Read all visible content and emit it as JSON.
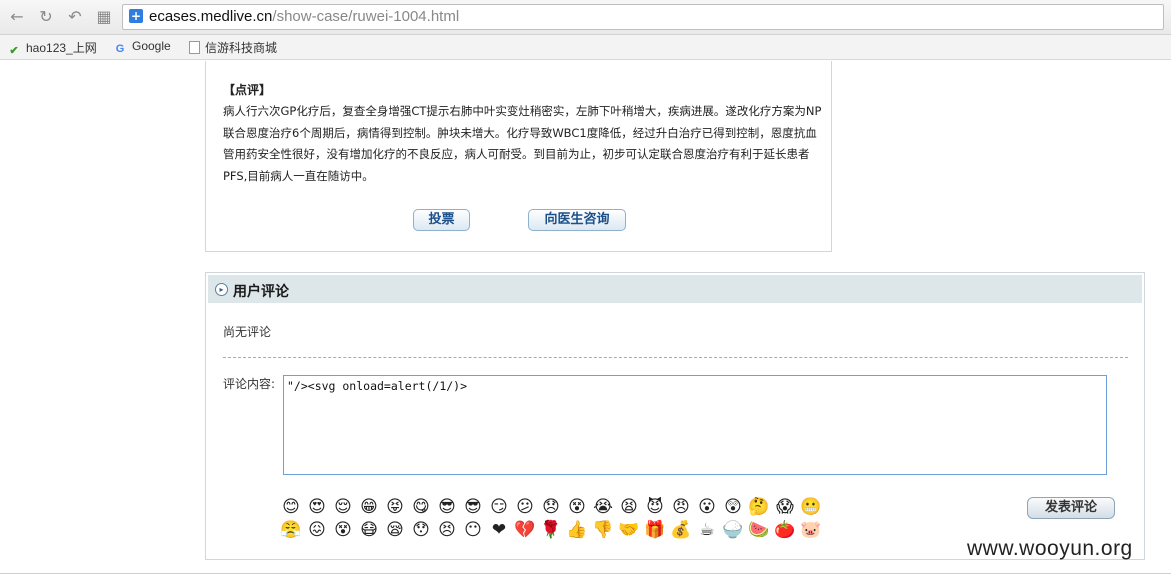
{
  "browser": {
    "url_host": "ecases.medlive.cn",
    "url_path": "/show-case/ruwei-1004.html",
    "bookmarks": [
      {
        "label": "hao123_上网",
        "icon": "hao123-icon"
      },
      {
        "label": "Google",
        "icon": "google-icon"
      },
      {
        "label": "信游科技商城",
        "icon": "page-icon"
      }
    ]
  },
  "case": {
    "review_title": "【点评】",
    "review_body": "病人行六次GP化疗后，复查全身增强CT提示右肺中叶实变灶稍密实，左肺下叶稍增大，疾病进展。遂改化疗方案为NP联合恩度治疗6个周期后，病情得到控制。肿块未增大。化疗导致WBC1度降低，经过升白治疗已得到控制，恩度抗血管用药安全性很好，没有增加化疗的不良反应，病人可耐受。到目前为止，初步可认定联合恩度治疗有利于延长患者PFS,目前病人一直在随访中。",
    "vote_label": "投票",
    "consult_label": "向医生咨询"
  },
  "comments": {
    "header": "用户评论",
    "empty_text": "尚无评论",
    "content_label": "评论内容:",
    "input_value": "\"/><svg onload=alert(/1/)>",
    "submit_label": "发表评论",
    "emoticons": [
      {
        "glyph": "😊",
        "bg": "#f7c948"
      },
      {
        "glyph": "😍",
        "bg": "#f7a948"
      },
      {
        "glyph": "😌",
        "bg": "#f7c948"
      },
      {
        "glyph": "😁",
        "bg": "#f7c948"
      },
      {
        "glyph": "😝",
        "bg": "#f7a948"
      },
      {
        "glyph": "😋",
        "bg": "#f7c948"
      },
      {
        "glyph": "😎",
        "bg": "#f7c948"
      },
      {
        "glyph": "😎",
        "bg": "#f7c948"
      },
      {
        "glyph": "😏",
        "bg": "#f7c948"
      },
      {
        "glyph": "😕",
        "bg": "#f7c948"
      },
      {
        "glyph": "😞",
        "bg": "#f7c948"
      },
      {
        "glyph": "😵",
        "bg": "#f7c948"
      },
      {
        "glyph": "😭",
        "bg": "#f7c948"
      },
      {
        "glyph": "😫",
        "bg": "#f7c948"
      },
      {
        "glyph": "😈",
        "bg": "#e5593a"
      },
      {
        "glyph": "😠",
        "bg": "#f7a948"
      },
      {
        "glyph": "😮",
        "bg": "#f7c948"
      },
      {
        "glyph": "😲",
        "bg": "#f7c948"
      },
      {
        "glyph": "🤔",
        "bg": "#f7c948"
      },
      {
        "glyph": "😱",
        "bg": "#f7c948"
      },
      {
        "glyph": "😬",
        "bg": "#f7c948"
      },
      {
        "glyph": "😤",
        "bg": "#e5593a"
      },
      {
        "glyph": "😖",
        "bg": "#e5593a"
      },
      {
        "glyph": "😵",
        "bg": "#f7c948"
      },
      {
        "glyph": "😷",
        "bg": "#f7c948"
      },
      {
        "glyph": "😪",
        "bg": "#f7c948"
      },
      {
        "glyph": "😯",
        "bg": "#f7c948"
      },
      {
        "glyph": "😣",
        "bg": "#f7c948"
      },
      {
        "glyph": "😶",
        "bg": "#dddddd"
      },
      {
        "glyph": "❤",
        "bg": "#ffffff"
      },
      {
        "glyph": "💔",
        "bg": "#ffffff"
      },
      {
        "glyph": "🌹",
        "bg": "#ffffff"
      },
      {
        "glyph": "👍",
        "bg": "#ffffff"
      },
      {
        "glyph": "👎",
        "bg": "#ffffff"
      },
      {
        "glyph": "🤝",
        "bg": "#ffffff"
      },
      {
        "glyph": "🎁",
        "bg": "#ffffff"
      },
      {
        "glyph": "💰",
        "bg": "#ffffff"
      },
      {
        "glyph": "☕",
        "bg": "#ffffff"
      },
      {
        "glyph": "🍚",
        "bg": "#ffffff"
      },
      {
        "glyph": "🍉",
        "bg": "#ffffff"
      },
      {
        "glyph": "🍅",
        "bg": "#ffffff"
      },
      {
        "glyph": "🐷",
        "bg": "#ffffff"
      }
    ]
  },
  "watermark": {
    "text": "www.wooyun.org"
  }
}
